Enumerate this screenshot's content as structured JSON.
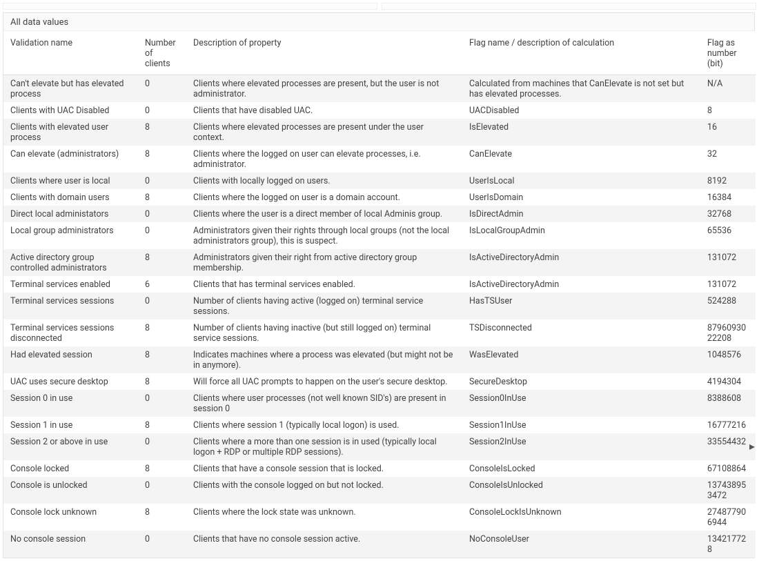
{
  "panelTitle": "All data values",
  "columns": {
    "name": "Validation name",
    "count": "Number of clients",
    "desc": "Description of property",
    "flag": "Flag name / description of calculation",
    "bits": "Flag as number (bit)"
  },
  "rows": [
    {
      "name": "Can't elevate but has elevated process",
      "count": "0",
      "desc": "Clients where elevated processes are present, but the user is not administrator.",
      "flag": "Calculated from machines that CanElevate is not set but has elevated processes.",
      "bits": "N/A"
    },
    {
      "name": "Clients with UAC Disabled",
      "count": "0",
      "desc": "Clients that have disabled UAC.",
      "flag": "UACDisabled",
      "bits": "8"
    },
    {
      "name": "Clients with elevated user process",
      "count": "8",
      "desc": "Clients where elevated processes are present under the user context.",
      "flag": "IsElevated",
      "bits": "16"
    },
    {
      "name": "Can elevate (administrators)",
      "count": "8",
      "desc": "Clients where the logged on user can elevate processes, i.e. administrator.",
      "flag": "CanElevate",
      "bits": "32"
    },
    {
      "name": "Clients where user is local",
      "count": "0",
      "desc": "Clients with locally logged on users.",
      "flag": "UserIsLocal",
      "bits": "8192"
    },
    {
      "name": "Clients with domain users",
      "count": "8",
      "desc": "Clients where the logged on user is a domain account.",
      "flag": "UserIsDomain",
      "bits": "16384"
    },
    {
      "name": "Direct local administators",
      "count": "0",
      "desc": "Clients where the user is a direct member of local Adminis group.",
      "flag": "IsDirectAdmin",
      "bits": "32768"
    },
    {
      "name": "Local group administrators",
      "count": "0",
      "desc": "Administrators given their rights through local groups (not the local administrators group), this is suspect.",
      "flag": "IsLocalGroupAdmin",
      "bits": "65536"
    },
    {
      "name": "Active directory group controlled administrators",
      "count": "8",
      "desc": "Administrators given their right from active directory group membership.",
      "flag": "IsActiveDirectoryAdmin",
      "bits": "131072"
    },
    {
      "name": "Terminal services enabled",
      "count": "6",
      "desc": "Clients that has terminal services enabled.",
      "flag": "IsActiveDirectoryAdmin",
      "bits": "131072"
    },
    {
      "name": "Terminal services sessions",
      "count": "0",
      "desc": "Number of clients having active (logged on) terminal service sessions.",
      "flag": "HasTSUser",
      "bits": "524288"
    },
    {
      "name": "Terminal services sessions disconnected",
      "count": "8",
      "desc": "Number of clients having inactive (but still logged on) terminal service sessions.",
      "flag": "TSDisconnected",
      "bits": "8796093022208"
    },
    {
      "name": "Had elevated session",
      "count": "8",
      "desc": "Indicates machines where a process was elevated (but might not be in anymore).",
      "flag": "WasElevated",
      "bits": "1048576"
    },
    {
      "name": "UAC uses secure desktop",
      "count": "8",
      "desc": "Will force all UAC prompts to happen on the user's secure desktop.",
      "flag": "SecureDesktop",
      "bits": "4194304"
    },
    {
      "name": "Session 0 in use",
      "count": "0",
      "desc": "Clients where user processes (not well known SID's) are present in session 0",
      "flag": "Session0InUse",
      "bits": "8388608"
    },
    {
      "name": "Session 1 in use",
      "count": "8",
      "desc": "Clients where session 1 (typically local logon) is used.",
      "flag": "Session1InUse",
      "bits": "16777216"
    },
    {
      "name": "Session 2 or above in use",
      "count": "0",
      "desc": "Clients where a more than one session is in used (typically local logon + RDP or multiple RDP sessions).",
      "flag": "Session2InUse",
      "bits": "33554432"
    },
    {
      "name": "Console locked",
      "count": "8",
      "desc": "Clients that have a console session that is locked.",
      "flag": "ConsoleIsLocked",
      "bits": "67108864"
    },
    {
      "name": "Console is unlocked",
      "count": "0",
      "desc": "Clients with the console logged on but not locked.",
      "flag": "ConsoleIsUnlocked",
      "bits": "137438953472"
    },
    {
      "name": "Console lock unknown",
      "count": "8",
      "desc": "Clients where the lock state was unknown.",
      "flag": "ConsoleLockIsUnknown",
      "bits": "274877906944"
    },
    {
      "name": "No console session",
      "count": "0",
      "desc": "Clients that have no console session active.",
      "flag": "NoConsoleUser",
      "bits": "134217728"
    }
  ]
}
